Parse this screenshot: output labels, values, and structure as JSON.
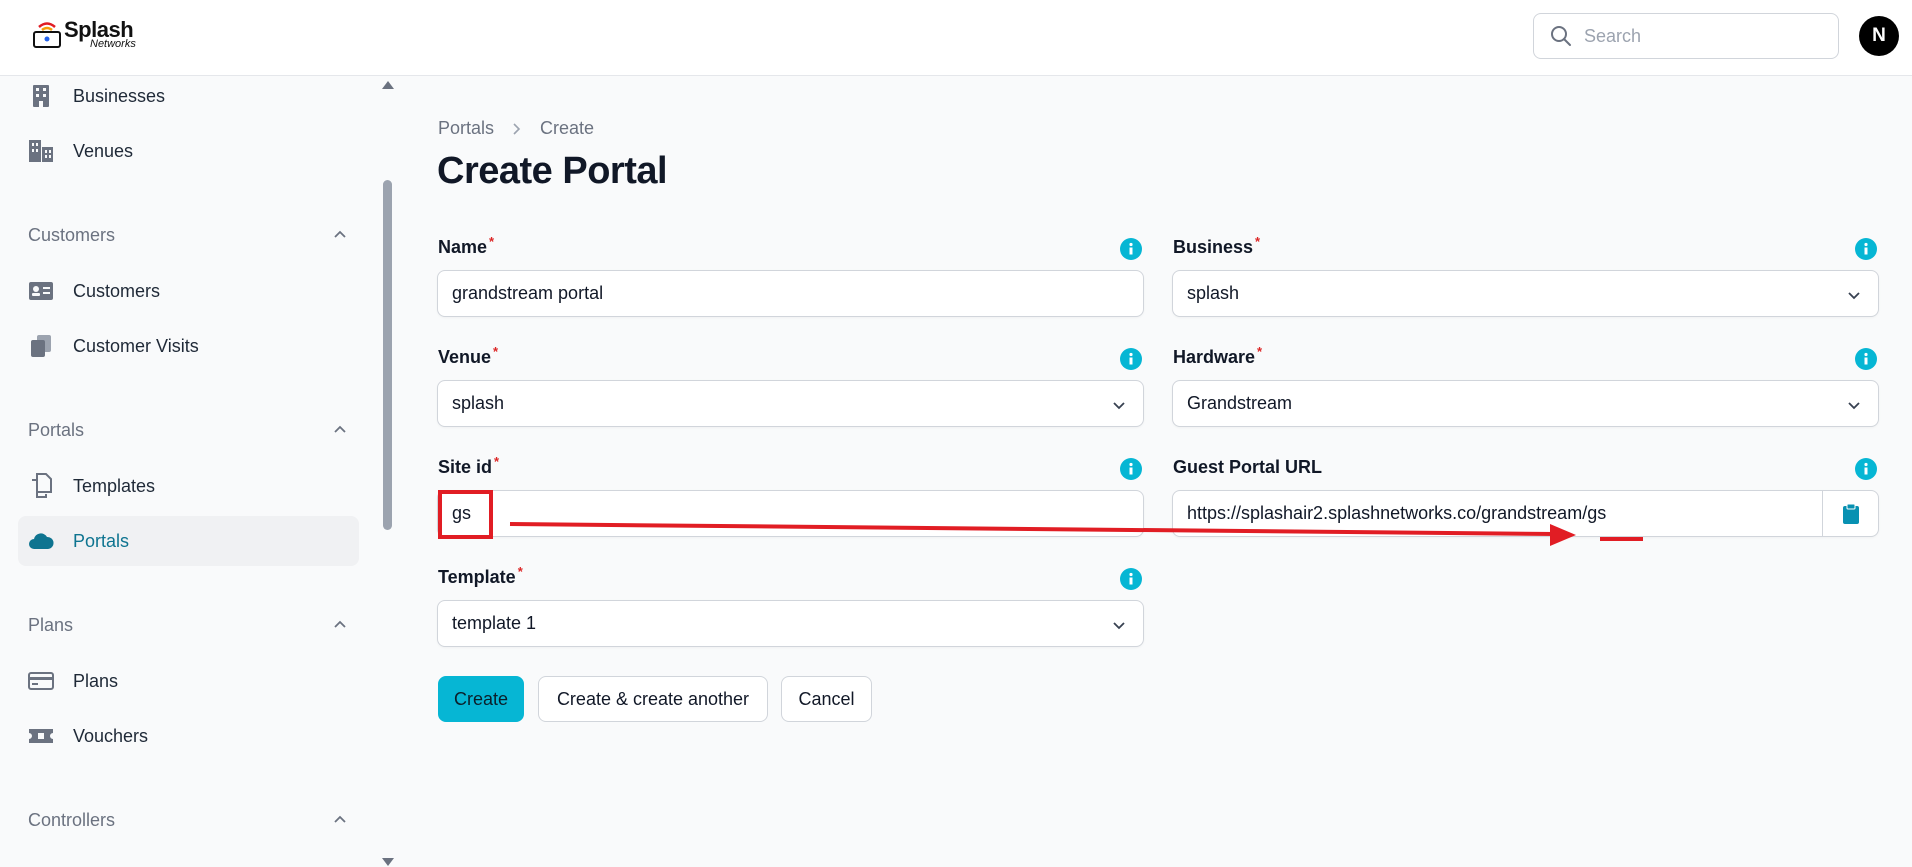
{
  "app": {
    "logo_main": "Splash",
    "logo_sub": "Networks"
  },
  "header": {
    "search_placeholder": "Search",
    "avatar_initial": "N"
  },
  "sidebar": {
    "items_top": [
      {
        "label": "Businesses",
        "icon": "building-icon"
      },
      {
        "label": "Venues",
        "icon": "buildings-icon"
      }
    ],
    "groups": [
      {
        "title": "Customers",
        "items": [
          {
            "label": "Customers",
            "icon": "id-card-icon"
          },
          {
            "label": "Customer Visits",
            "icon": "documents-icon"
          }
        ]
      },
      {
        "title": "Portals",
        "items": [
          {
            "label": "Templates",
            "icon": "document-duplicate-icon"
          },
          {
            "label": "Portals",
            "icon": "cloud-icon",
            "active": true
          }
        ]
      },
      {
        "title": "Plans",
        "items": [
          {
            "label": "Plans",
            "icon": "credit-card-icon"
          },
          {
            "label": "Vouchers",
            "icon": "ticket-icon"
          }
        ]
      },
      {
        "title": "Controllers",
        "items": []
      }
    ]
  },
  "main": {
    "breadcrumb": [
      "Portals",
      "Create"
    ],
    "title": "Create Portal",
    "fields": {
      "name": {
        "label": "Name",
        "value": "grandstream portal"
      },
      "business": {
        "label": "Business",
        "value": "splash"
      },
      "venue": {
        "label": "Venue",
        "value": "splash"
      },
      "hardware": {
        "label": "Hardware",
        "value": "Grandstream"
      },
      "site_id": {
        "label": "Site id",
        "value": "gs"
      },
      "guest_portal_url": {
        "label": "Guest Portal URL",
        "value": "https://splashair2.splashnetworks.co/grandstream/gs"
      },
      "template": {
        "label": "Template",
        "value": "template 1"
      }
    },
    "required_mark": "*",
    "buttons": {
      "create": "Create",
      "create_another": "Create & create another",
      "cancel": "Cancel"
    }
  },
  "colors": {
    "accent": "#06b6d4",
    "active_text": "#0e7490",
    "annotation": "#e11d24"
  }
}
